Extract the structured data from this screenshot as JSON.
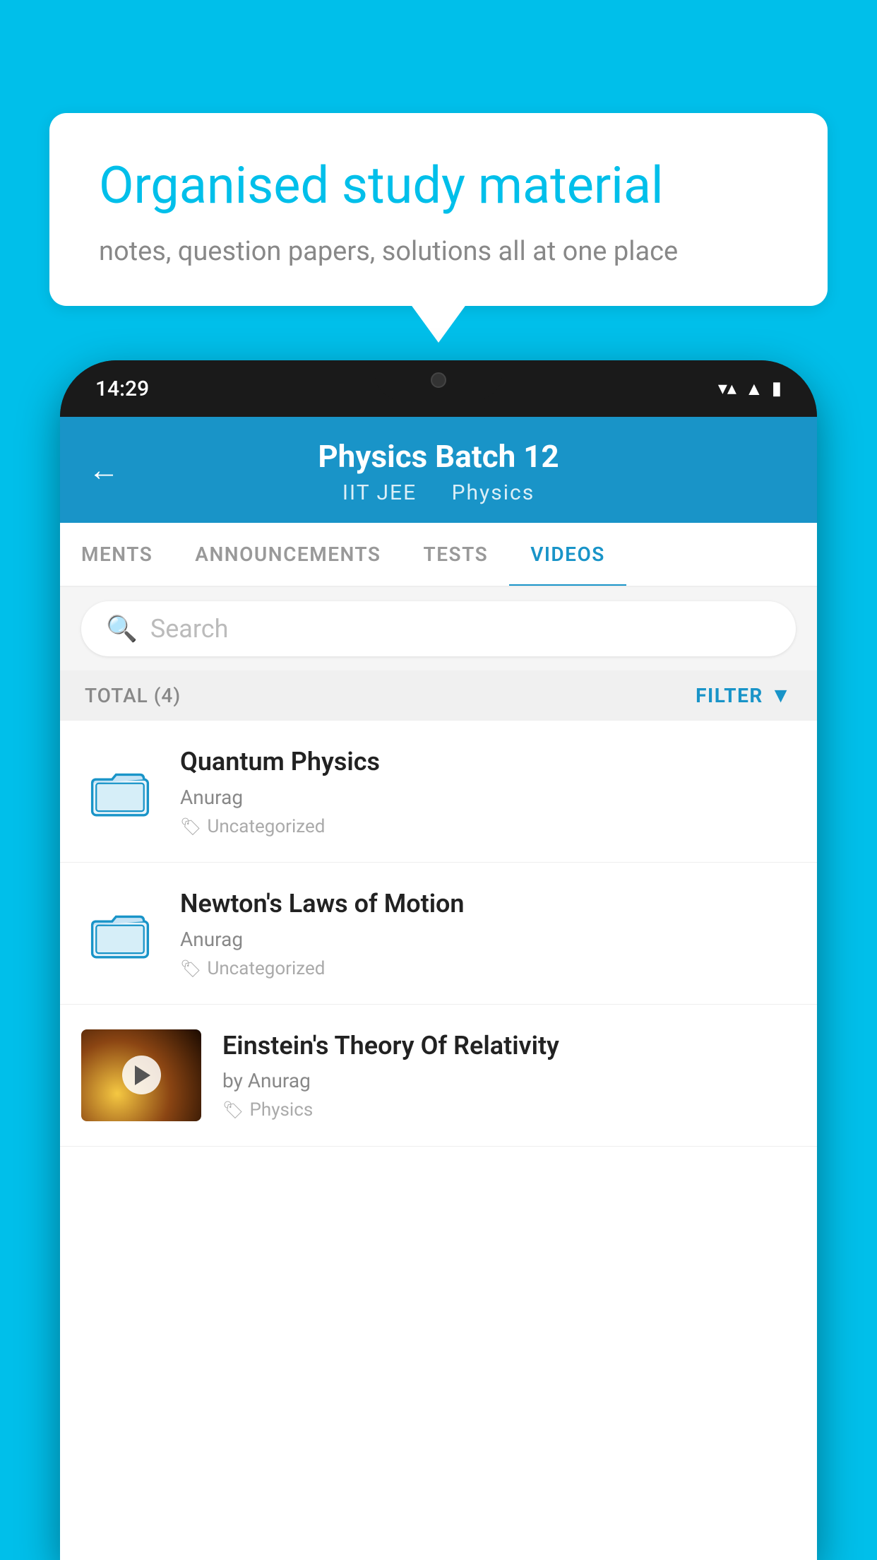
{
  "background_color": "#00BFEA",
  "speech_bubble": {
    "title": "Organised study material",
    "subtitle": "notes, question papers, solutions all at one place"
  },
  "phone": {
    "status_bar": {
      "time": "14:29",
      "icons": [
        "wifi",
        "signal",
        "battery"
      ]
    },
    "header": {
      "back_label": "←",
      "title": "Physics Batch 12",
      "subtitle_part1": "IIT JEE",
      "subtitle_part2": "Physics"
    },
    "tabs": [
      {
        "label": "MENTS",
        "active": false
      },
      {
        "label": "ANNOUNCEMENTS",
        "active": false
      },
      {
        "label": "TESTS",
        "active": false
      },
      {
        "label": "VIDEOS",
        "active": true
      }
    ],
    "search": {
      "placeholder": "Search"
    },
    "filter_bar": {
      "total_label": "TOTAL (4)",
      "filter_label": "FILTER"
    },
    "videos": [
      {
        "title": "Quantum Physics",
        "author": "Anurag",
        "tag": "Uncategorized",
        "has_thumbnail": false
      },
      {
        "title": "Newton's Laws of Motion",
        "author": "Anurag",
        "tag": "Uncategorized",
        "has_thumbnail": false
      },
      {
        "title": "Einstein's Theory Of Relativity",
        "author": "by Anurag",
        "tag": "Physics",
        "has_thumbnail": true
      }
    ]
  }
}
